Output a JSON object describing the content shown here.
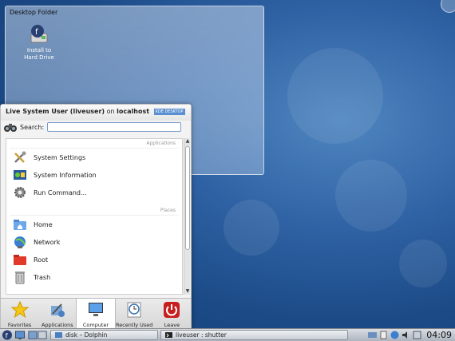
{
  "desktop_folder": {
    "title": "Desktop Folder",
    "icons": [
      {
        "label": "Install to Hard Drive",
        "icon": "fedora-disk-icon"
      }
    ]
  },
  "menu": {
    "user_label": "Live System User (liveuser)",
    "on_text": "on",
    "host": "localhost",
    "badge": "KDE DESKTOP",
    "search_label": "Search:",
    "search_value": "",
    "sections": {
      "applications": "Applications",
      "places": "Places"
    },
    "applications": [
      {
        "label": "System Settings",
        "icon": "tools-icon"
      },
      {
        "label": "System Information",
        "icon": "system-info-icon"
      },
      {
        "label": "Run Command...",
        "icon": "gear-icon"
      }
    ],
    "places": [
      {
        "label": "Home",
        "icon": "home-folder-icon"
      },
      {
        "label": "Network",
        "icon": "globe-icon"
      },
      {
        "label": "Root",
        "icon": "red-folder-icon"
      },
      {
        "label": "Trash",
        "icon": "trash-icon"
      }
    ],
    "tabs": [
      {
        "label": "Favorites",
        "icon": "star-icon"
      },
      {
        "label": "Applications",
        "icon": "applications-icon"
      },
      {
        "label": "Computer",
        "icon": "computer-icon",
        "active": true
      },
      {
        "label": "Recently Used",
        "icon": "clock-icon"
      },
      {
        "label": "Leave",
        "icon": "power-icon"
      }
    ]
  },
  "taskbar": {
    "tasks": [
      {
        "label": "disk – Dolphin",
        "icon": "dolphin-icon"
      },
      {
        "label": "liveuser : shutter",
        "icon": "terminal-icon"
      }
    ],
    "clock": "04:09"
  },
  "colors": {
    "accent": "#2f62a4",
    "leave": "#c81e1e"
  }
}
